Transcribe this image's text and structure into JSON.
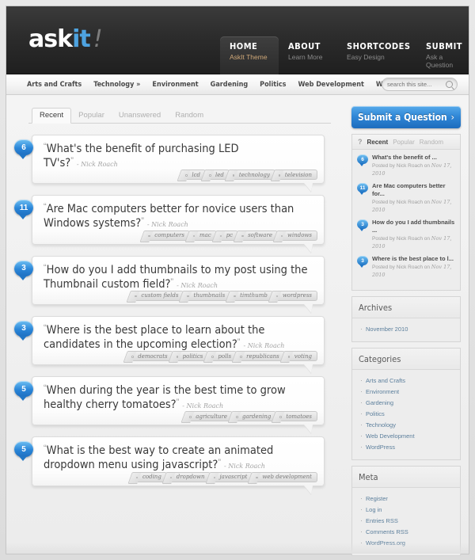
{
  "site": {
    "logo_part1": "ask",
    "logo_part2": "it",
    "logo_mark": "!"
  },
  "topnav": [
    {
      "title": "HOME",
      "subtitle": "AskIt Theme",
      "active": true
    },
    {
      "title": "ABOUT",
      "subtitle": "Learn More",
      "active": false
    },
    {
      "title": "SHORTCODES",
      "subtitle": "Easy Design",
      "active": false
    },
    {
      "title": "SUBMIT",
      "subtitle": "Ask a Question",
      "active": false
    }
  ],
  "subnav": [
    "Arts and Crafts",
    "Technology »",
    "Environment",
    "Gardening",
    "Politics",
    "Web Development",
    "WordPress"
  ],
  "search": {
    "placeholder": "search this site...",
    "value": ""
  },
  "content_tabs": [
    {
      "label": "Recent",
      "active": true
    },
    {
      "label": "Popular",
      "active": false
    },
    {
      "label": "Unanswered",
      "active": false
    },
    {
      "label": "Random",
      "active": false
    }
  ],
  "questions": [
    {
      "count": "6",
      "text": "What's the benefit of purchasing LED TV's?",
      "author": "- Nick Roach",
      "tags": [
        "lcd",
        "led",
        "technology",
        "television"
      ]
    },
    {
      "count": "11",
      "text": "Are Mac computers better for novice users than Windows systems?",
      "author": "- Nick Roach",
      "tags": [
        "computers",
        "mac",
        "pc",
        "software",
        "windows"
      ]
    },
    {
      "count": "3",
      "text": "How do you I add thumbnails to my post using the Thumbnail custom field?",
      "author": "- Nick Roach",
      "tags": [
        "custom fields",
        "thumbnails",
        "timthumb",
        "wordpress"
      ]
    },
    {
      "count": "3",
      "text": "Where is the best place to learn about the candidates in the upcoming election?",
      "author": "- Nick Roach",
      "tags": [
        "democrats",
        "politics",
        "polls",
        "republicans",
        "voting"
      ]
    },
    {
      "count": "5",
      "text": "When during the year is the best time to grow healthy cherry tomatoes?",
      "author": "- Nick Roach",
      "tags": [
        "agriculture",
        "gardening",
        "tomatoes"
      ]
    },
    {
      "count": "5",
      "text": "What is the best way to create an animated dropdown menu using javascript?",
      "author": "- Nick Roach",
      "tags": [
        "coding",
        "dropdown",
        "javascript",
        "web development"
      ]
    }
  ],
  "sidebar": {
    "submit_button": "Submit a Question",
    "submit_arrow": "›",
    "question_icon": "?",
    "panel_tabs": [
      {
        "label": "Recent",
        "active": true
      },
      {
        "label": "Popular",
        "active": false
      },
      {
        "label": "Random",
        "active": false
      }
    ],
    "recent_questions": [
      {
        "count": "6",
        "title": "What's the benefit of ...",
        "meta_prefix": "Posted by Nick Roach on ",
        "meta_date": "Nov 17, 2010"
      },
      {
        "count": "11",
        "title": "Are Mac computers better for...",
        "meta_prefix": "Posted by Nick Roach on ",
        "meta_date": "Nov 17, 2010"
      },
      {
        "count": "3",
        "title": "How do you I add thumbnails ...",
        "meta_prefix": "Posted by Nick Roach on ",
        "meta_date": "Nov 17, 2010"
      },
      {
        "count": "3",
        "title": "Where is the best place to l...",
        "meta_prefix": "Posted by Nick Roach on ",
        "meta_date": "Nov 17, 2010"
      }
    ],
    "widgets": [
      {
        "title": "Archives",
        "items": [
          "November 2010"
        ]
      },
      {
        "title": "Categories",
        "items": [
          "Arts and Crafts",
          "Environment",
          "Gardening",
          "Politics",
          "Technology",
          "Web Development",
          "WordPress"
        ]
      },
      {
        "title": "Meta",
        "items": [
          "Register",
          "Log in",
          "Entries RSS",
          "Comments RSS",
          "WordPress.org"
        ]
      }
    ]
  },
  "colors": {
    "accent_blue": "#2f86d6",
    "header_dark": "#2c2c2c",
    "active_sub": "#cfa878"
  }
}
